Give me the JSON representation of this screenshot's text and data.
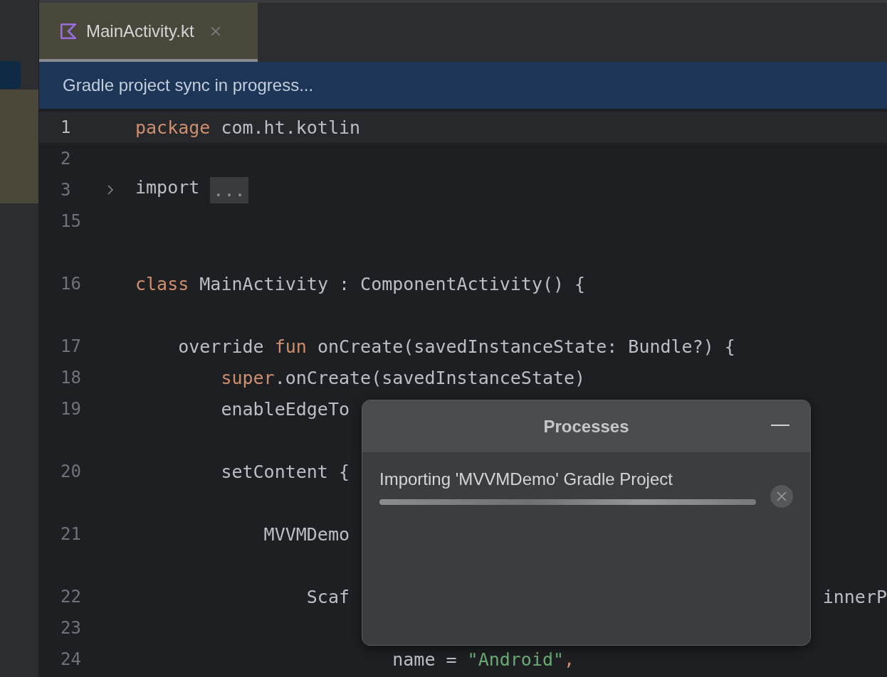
{
  "tabs": [
    {
      "label": "MainActivity.kt",
      "selected": true
    }
  ],
  "banner": {
    "text": "Gradle project sync in progress..."
  },
  "editor": {
    "lines": [
      {
        "number": "1",
        "current": true,
        "gap_before": false,
        "tokens": [
          {
            "kind": "keyword",
            "text": "package"
          },
          {
            "kind": "plain",
            "text": " com.ht.kotlin"
          }
        ]
      },
      {
        "number": "2",
        "current": false,
        "gap_before": false
      },
      {
        "number": "3",
        "current": false,
        "gap_before": false,
        "foldable": true,
        "tokens": [
          {
            "kind": "plain",
            "text": "import "
          },
          {
            "kind": "folded",
            "text": "..."
          }
        ]
      },
      {
        "number": "15",
        "current": false,
        "gap_before": false
      },
      {
        "number": "16",
        "current": false,
        "gap_before": true,
        "tokens": [
          {
            "kind": "keyword",
            "text": "class"
          },
          {
            "kind": "plain",
            "text": " MainActivity : ComponentActivity() {"
          }
        ]
      },
      {
        "number": "17",
        "current": false,
        "gap_before": true,
        "tokens": [
          {
            "kind": "plain",
            "text": "    override "
          },
          {
            "kind": "keyword",
            "text": "fun"
          },
          {
            "kind": "plain",
            "text": " onCreate(savedInstanceState: Bundle?) {"
          }
        ]
      },
      {
        "number": "18",
        "current": false,
        "gap_before": false,
        "tokens": [
          {
            "kind": "keyword",
            "text": "        super"
          },
          {
            "kind": "plain",
            "text": ".onCreate(savedInstanceState)"
          }
        ]
      },
      {
        "number": "19",
        "current": false,
        "gap_before": false,
        "tokens": [
          {
            "kind": "plain",
            "text": "        enableEdgeTo"
          }
        ]
      },
      {
        "number": "20",
        "current": false,
        "gap_before": true,
        "tokens": [
          {
            "kind": "plain",
            "text": "        setContent {"
          }
        ]
      },
      {
        "number": "21",
        "current": false,
        "gap_before": true,
        "tokens": [
          {
            "kind": "plain",
            "text": "            MVVMDemo"
          }
        ]
      },
      {
        "number": "22",
        "current": false,
        "gap_before": true,
        "tokens": [
          {
            "kind": "plain",
            "text": "                Scaf"
          },
          {
            "kind": "tail",
            "text": "innerP"
          }
        ]
      },
      {
        "number": "23",
        "current": false,
        "gap_before": false
      },
      {
        "number": "24",
        "current": false,
        "gap_before": false,
        "tokens": [
          {
            "kind": "plain",
            "text": "                        name = "
          },
          {
            "kind": "string",
            "text": "\"Android\""
          },
          {
            "kind": "keyword",
            "text": ","
          }
        ]
      }
    ]
  },
  "processes": {
    "title": "Processes",
    "items": [
      {
        "text": "Importing 'MVVMDemo' Gradle Project",
        "level": 1
      }
    ]
  }
}
